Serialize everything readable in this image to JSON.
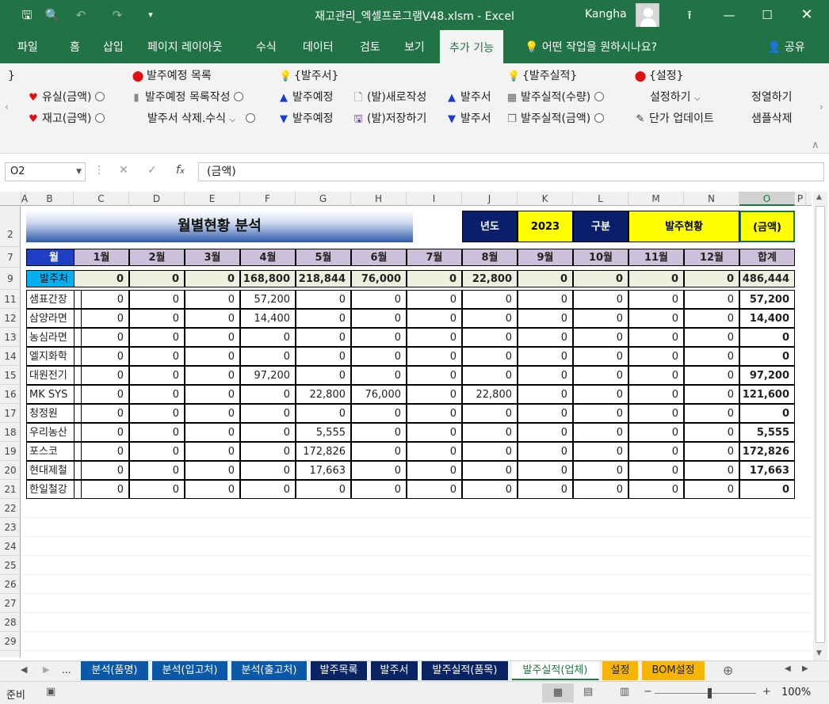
{
  "titlebar": {
    "doc_title": "재고관리_엑셀프로그램V48.xlsm  -  Excel",
    "user": "Kangha"
  },
  "tabs": [
    "파일",
    "홈",
    "삽입",
    "페이지 레이아웃",
    "수식",
    "데이터",
    "검토",
    "보기",
    "추가 기능"
  ],
  "tell_me": "어떤 작업을 원하시나요?",
  "share": "공유",
  "ribbon": {
    "headers": [
      "}",
      "발주예정 목록",
      "{발주서}",
      "{발주실적}",
      "{설정}"
    ],
    "row1": [
      "유실(금액)",
      "발주예정 목록작성",
      "발주예정",
      "(발)새로작성",
      "발주서",
      "발주실적(수량)",
      "설정하기",
      "정열하기"
    ],
    "row2": [
      "재고(금액)",
      "발주서 삭제.수식",
      "발주예정",
      "(발)저장하기",
      "발주서",
      "발주실적(금액)",
      "단가 업데이트",
      "샘플삭제"
    ]
  },
  "formula_bar": {
    "name_box": "O2",
    "formula": "(금액)"
  },
  "columns": [
    "A",
    "B",
    "C",
    "D",
    "E",
    "F",
    "G",
    "H",
    "I",
    "J",
    "K",
    "L",
    "M",
    "N",
    "O",
    "P"
  ],
  "selected_column": "O",
  "rows": [
    "2",
    "7",
    "9",
    "11",
    "12",
    "13",
    "14",
    "15",
    "16",
    "17",
    "18",
    "19",
    "20",
    "21",
    "22",
    "23",
    "24",
    "25",
    "26",
    "27",
    "28",
    "29"
  ],
  "sheet": {
    "title": "월별현황 분석",
    "year_label": "년도",
    "year_value": "2023",
    "type_label": "구분",
    "type_value": "발주현황",
    "unit_value": "(금액)",
    "header_month": "월",
    "months": [
      "1월",
      "2월",
      "3월",
      "4월",
      "5월",
      "6월",
      "7월",
      "8월",
      "9월",
      "10월",
      "11월",
      "12월"
    ],
    "total_header": "합계",
    "summary_label": "발주처",
    "summary_values": [
      "0",
      "0",
      "0",
      "168,800",
      "218,844",
      "76,000",
      "0",
      "22,800",
      "0",
      "0",
      "0",
      "0"
    ],
    "summary_total": "486,444",
    "vendors": [
      {
        "name": "샘표간장",
        "values": [
          "0",
          "0",
          "0",
          "57,200",
          "0",
          "0",
          "0",
          "0",
          "0",
          "0",
          "0",
          "0"
        ],
        "total": "57,200"
      },
      {
        "name": "삼양라면",
        "values": [
          "0",
          "0",
          "0",
          "14,400",
          "0",
          "0",
          "0",
          "0",
          "0",
          "0",
          "0",
          "0"
        ],
        "total": "14,400"
      },
      {
        "name": "농심라면",
        "values": [
          "0",
          "0",
          "0",
          "0",
          "0",
          "0",
          "0",
          "0",
          "0",
          "0",
          "0",
          "0"
        ],
        "total": "0"
      },
      {
        "name": "엘지화학",
        "values": [
          "0",
          "0",
          "0",
          "0",
          "0",
          "0",
          "0",
          "0",
          "0",
          "0",
          "0",
          "0"
        ],
        "total": "0"
      },
      {
        "name": "대원전기",
        "values": [
          "0",
          "0",
          "0",
          "97,200",
          "0",
          "0",
          "0",
          "0",
          "0",
          "0",
          "0",
          "0"
        ],
        "total": "97,200"
      },
      {
        "name": "MK SYS",
        "values": [
          "0",
          "0",
          "0",
          "0",
          "22,800",
          "76,000",
          "0",
          "22,800",
          "0",
          "0",
          "0",
          "0"
        ],
        "total": "121,600"
      },
      {
        "name": "청정원",
        "values": [
          "0",
          "0",
          "0",
          "0",
          "0",
          "0",
          "0",
          "0",
          "0",
          "0",
          "0",
          "0"
        ],
        "total": "0"
      },
      {
        "name": "우리농산",
        "values": [
          "0",
          "0",
          "0",
          "0",
          "5,555",
          "0",
          "0",
          "0",
          "0",
          "0",
          "0",
          "0"
        ],
        "total": "5,555"
      },
      {
        "name": "포스코",
        "values": [
          "0",
          "0",
          "0",
          "0",
          "172,826",
          "0",
          "0",
          "0",
          "0",
          "0",
          "0",
          "0"
        ],
        "total": "172,826"
      },
      {
        "name": "현대제철",
        "values": [
          "0",
          "0",
          "0",
          "0",
          "17,663",
          "0",
          "0",
          "0",
          "0",
          "0",
          "0",
          "0"
        ],
        "total": "17,663"
      },
      {
        "name": "한일철강",
        "values": [
          "0",
          "0",
          "0",
          "0",
          "0",
          "0",
          "0",
          "0",
          "0",
          "0",
          "0",
          "0"
        ],
        "total": "0"
      }
    ]
  },
  "sheet_tabs": {
    "more": "...",
    "items": [
      "분석(품명)",
      "분석(입고처)",
      "분석(출고처)",
      "발주목록",
      "발주서",
      "발주실적(품목)",
      "발주실적(업체)",
      "설정",
      "BOM설정"
    ],
    "active": "발주실적(업체)"
  },
  "statusbar": {
    "ready": "준비",
    "zoom": "100%",
    "minus": "−",
    "plus": "+"
  },
  "colors": {
    "excel_green": "#217346",
    "navy": "#0a1f6b",
    "yellow": "#ffff00",
    "header_lilac": "#ccc0da",
    "summary_bg": "#ebf1de",
    "month_blue": "#1f3fc4",
    "vendor_cyan": "#00b0f0"
  }
}
